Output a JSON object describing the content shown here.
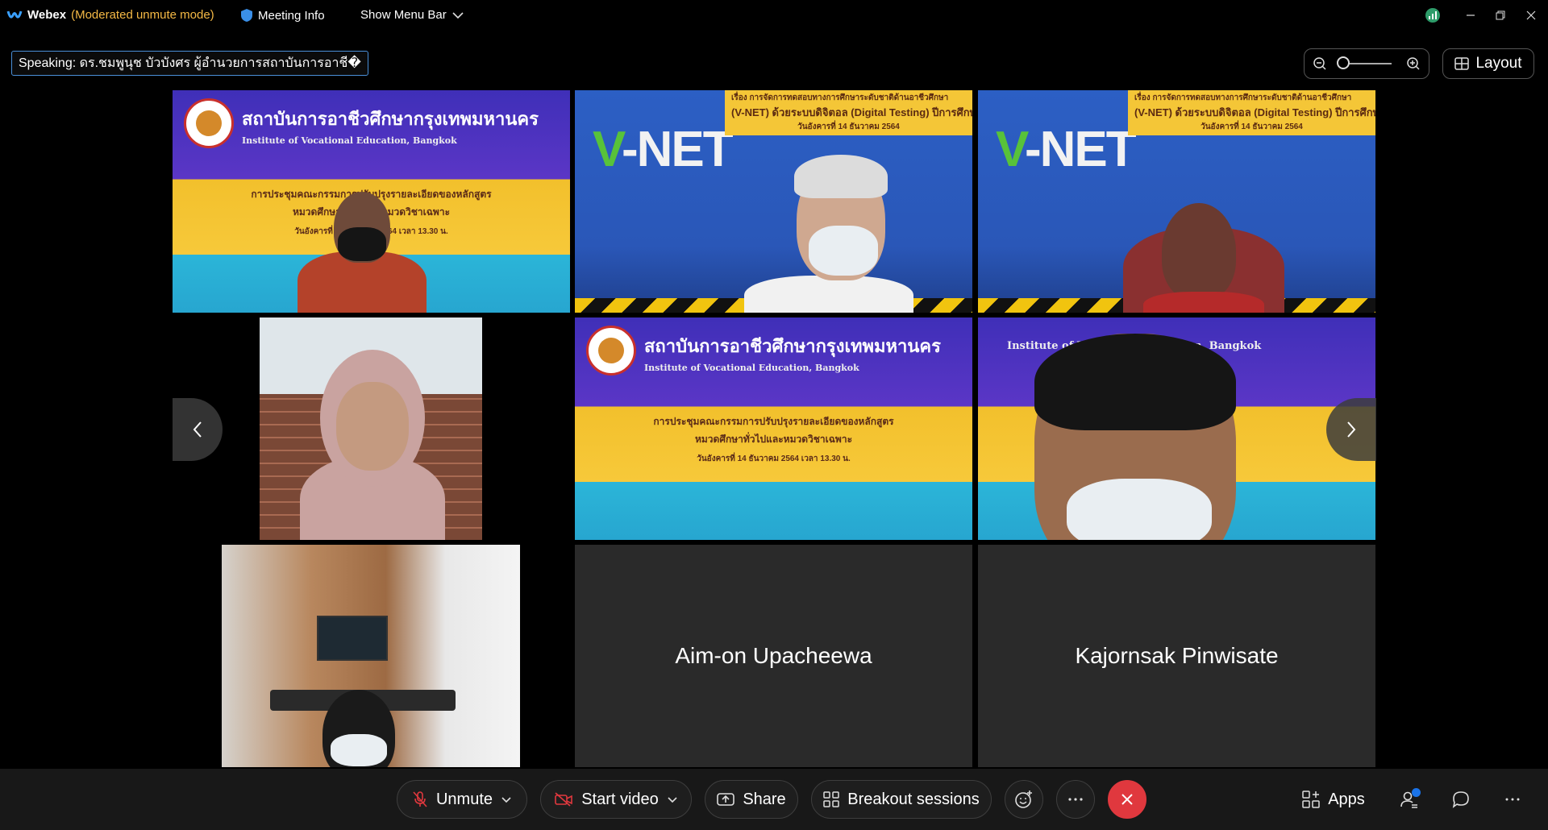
{
  "titlebar": {
    "app_name": "Webex",
    "mode": "(Moderated unmute mode)",
    "meeting_info": "Meeting Info",
    "show_menu_bar": "Show Menu Bar"
  },
  "speaking": "Speaking: ดร.ชมพูนุช บัวบังศร ผู้อำนวยการสถาบันการอาชี�",
  "layout_label": "Layout",
  "slides": {
    "title": "สถาบันการอาชีวศึกษากรุงเทพมหานคร",
    "subtitle": "Institute of Vocational Education, Bangkok",
    "line1": "การประชุมคณะกรรมการปรับปรุงรายละเอียดของหลักสูตร",
    "line2": "หมวดศึกษาทั่วไปและหมวดวิชาเฉพาะ",
    "line3": "วันอังคารที่ 14 ธันวาคม 2564 เวลา 13.30 น."
  },
  "vnet": {
    "text": "-NET",
    "letter": "V",
    "banner1": "เรื่อง การจัดการทดสอบทางการศึกษาระดับชาติด้านอาชีวศึกษา",
    "banner2": "(V-NET) ด้วยระบบดิจิตอล (Digital Testing) ปีการศึกษา",
    "banner3": "วันอังคารที่ 14 ธันวาคม 2564"
  },
  "participants": {
    "p8": "Aim-on Upacheewa",
    "p9": "Kajornsak Pinwisate"
  },
  "toolbar": {
    "unmute": "Unmute",
    "start_video": "Start video",
    "share": "Share",
    "breakout": "Breakout sessions",
    "apps": "Apps"
  },
  "colors": {
    "accent": "#4a90d9",
    "mode": "#f5b945",
    "end_call": "#e0383e",
    "notify": "#1a73e8"
  }
}
